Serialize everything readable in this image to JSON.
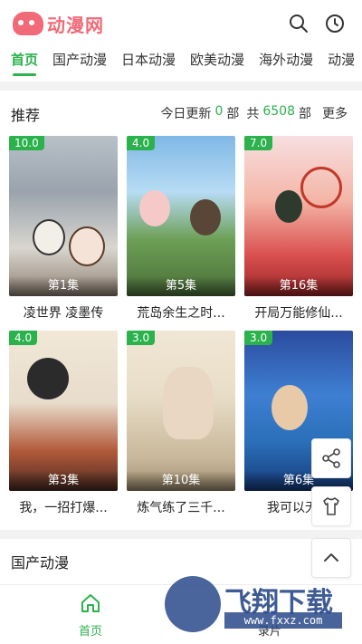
{
  "header": {
    "logo_text": "动漫网",
    "search_icon": "search-icon",
    "history_icon": "history-clock-icon"
  },
  "tabs": [
    {
      "label": "首页",
      "active": true
    },
    {
      "label": "国产动漫",
      "active": false
    },
    {
      "label": "日本动漫",
      "active": false
    },
    {
      "label": "欧美动漫",
      "active": false
    },
    {
      "label": "海外动漫",
      "active": false
    },
    {
      "label": "动漫",
      "active": false
    }
  ],
  "recommend": {
    "title": "推荐",
    "today_label": "今日更新",
    "today_count": "0",
    "unit1": "部",
    "total_label": "共",
    "total_count": "6508",
    "unit2": "部",
    "more": "更多",
    "items": [
      {
        "score": "10.0",
        "episode": "第1集",
        "title": "凌世界 凌墨传"
      },
      {
        "score": "4.0",
        "episode": "第5集",
        "title": "荒岛余生之时..."
      },
      {
        "score": "7.0",
        "episode": "第16集",
        "title": "开局万能修仙..."
      },
      {
        "score": "4.0",
        "episode": "第3集",
        "title": "我，一招打爆..."
      },
      {
        "score": "3.0",
        "episode": "第10集",
        "title": "炼气练了三千..."
      },
      {
        "score": "3.0",
        "episode": "第6集",
        "title": "我可以无限"
      }
    ]
  },
  "section2": {
    "title": "国产动漫"
  },
  "floating": {
    "share_icon": "share-icon",
    "tshirt_icon": "tshirt-icon",
    "up_icon": "chevron-up-icon"
  },
  "bottom_nav": [
    {
      "label": "首页",
      "icon": "home-icon",
      "active": true
    },
    {
      "label": "录片",
      "icon": "",
      "active": false
    }
  ],
  "watermark": {
    "text": "飞翔下载",
    "sub": "www.fxxz.com"
  },
  "colors": {
    "accent": "#2bb24c",
    "logo": "#f06a78"
  }
}
